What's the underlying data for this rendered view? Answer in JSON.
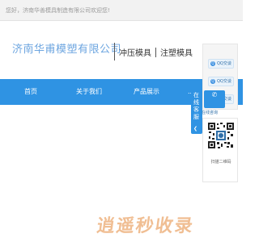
{
  "topbar": {
    "welcome_text": "您好，济南华善模具制造有限公司欢迎您!"
  },
  "header": {
    "logo_text": "济南华甫模塑有限公司",
    "slogan_left": "冲压模具",
    "slogan_right": "注塑模具"
  },
  "nav": {
    "items": [
      {
        "label": "首页"
      },
      {
        "label": "关于我们"
      },
      {
        "label": "产品展示"
      },
      {
        "label": "..."
      }
    ]
  },
  "sidetab": {
    "label": "在线客服"
  },
  "service_panel": {
    "qq_buttons": [
      {
        "label": "QQ交谈"
      },
      {
        "label": "QQ交谈"
      },
      {
        "label": "QQ交谈"
      }
    ],
    "online_label": "在线咨询",
    "qr_caption": "扫描二维码"
  },
  "watermark": {
    "text": "逍遥秒收录"
  },
  "colors": {
    "accent": "#2f93e3",
    "logo": "#6ea6e0",
    "watermark": "#e58a3c"
  }
}
